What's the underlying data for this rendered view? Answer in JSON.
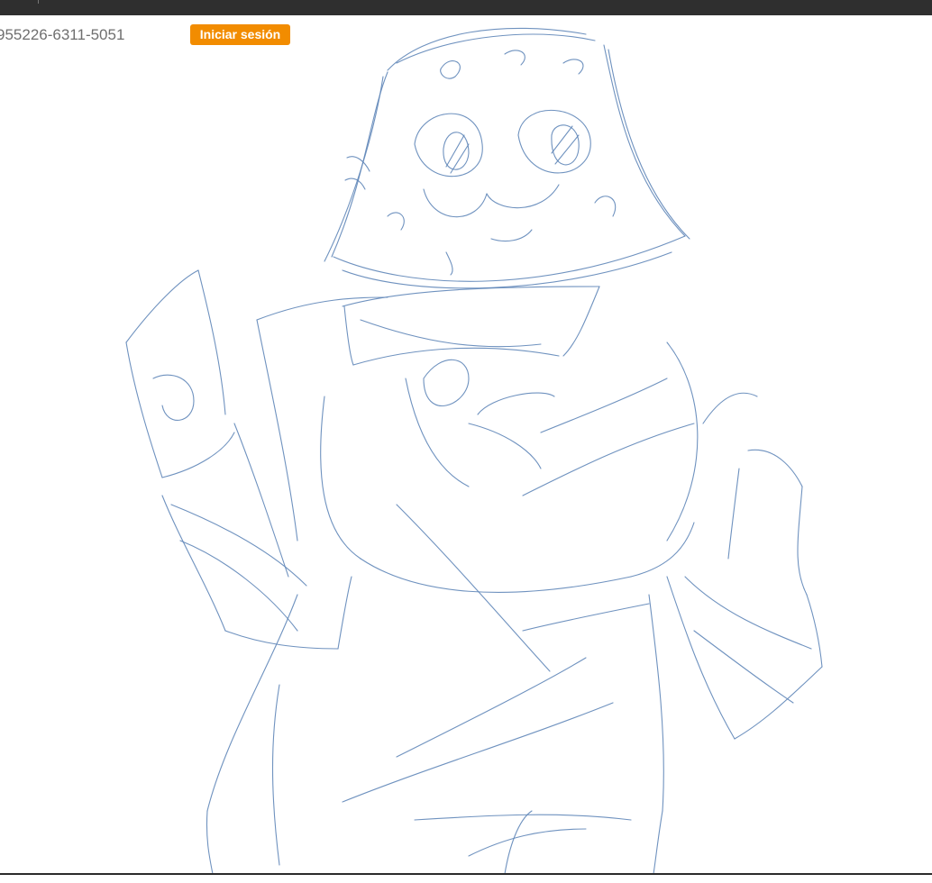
{
  "header": {
    "phone": "955226-6311-5051",
    "login_label": "Iniciar sesión"
  },
  "colors": {
    "login_button": "#f28c00",
    "sketch_stroke": "#5f86b8",
    "top_bar": "#2f2f2f"
  },
  "icons": {
    "canvas": "sketch-drawing"
  }
}
